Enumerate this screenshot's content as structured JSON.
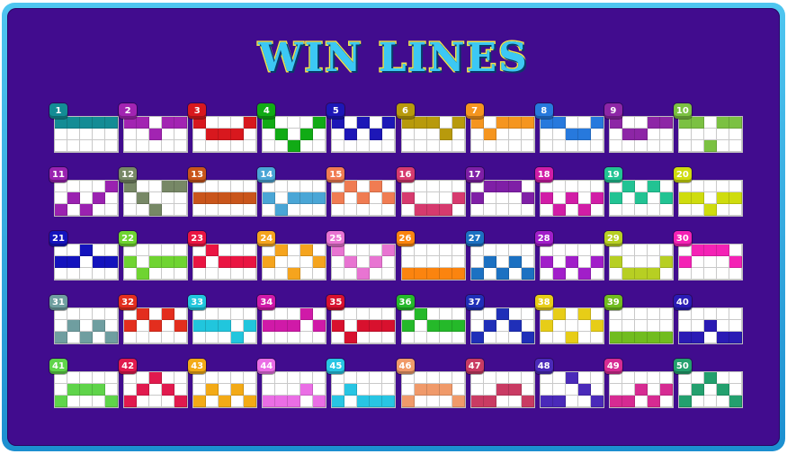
{
  "title": "WIN LINES",
  "lines": [
    {
      "num": "1",
      "color": "#138c95",
      "pattern": [
        0,
        0,
        0,
        0,
        0
      ]
    },
    {
      "num": "2",
      "color": "#a224b2",
      "pattern": [
        0,
        0,
        1,
        0,
        0
      ]
    },
    {
      "num": "3",
      "color": "#d8181e",
      "pattern": [
        0,
        1,
        1,
        1,
        0
      ]
    },
    {
      "num": "4",
      "color": "#11ab15",
      "pattern": [
        0,
        1,
        2,
        1,
        0
      ]
    },
    {
      "num": "5",
      "color": "#1d17b7",
      "pattern": [
        0,
        1,
        0,
        1,
        0
      ]
    },
    {
      "num": "6",
      "color": "#b89a0c",
      "pattern": [
        0,
        0,
        0,
        1,
        0
      ]
    },
    {
      "num": "7",
      "color": "#f5951f",
      "pattern": [
        0,
        1,
        0,
        0,
        0
      ]
    },
    {
      "num": "8",
      "color": "#2779dd",
      "pattern": [
        0,
        0,
        1,
        1,
        0
      ]
    },
    {
      "num": "9",
      "color": "#8d26a6",
      "pattern": [
        0,
        1,
        1,
        0,
        0
      ]
    },
    {
      "num": "10",
      "color": "#7bc142",
      "pattern": [
        0,
        0,
        2,
        0,
        0
      ]
    },
    {
      "num": "11",
      "color": "#9a22b0",
      "pattern": [
        2,
        1,
        2,
        1,
        0
      ]
    },
    {
      "num": "12",
      "color": "#778866",
      "pattern": [
        0,
        1,
        2,
        0,
        0
      ]
    },
    {
      "num": "13",
      "color": "#c9551b",
      "pattern": [
        1,
        1,
        1,
        1,
        1
      ]
    },
    {
      "num": "14",
      "color": "#4aa6d6",
      "pattern": [
        1,
        2,
        1,
        1,
        1
      ]
    },
    {
      "num": "15",
      "color": "#f07c52",
      "pattern": [
        1,
        0,
        1,
        0,
        1
      ]
    },
    {
      "num": "16",
      "color": "#d63a6e",
      "pattern": [
        1,
        2,
        2,
        2,
        1
      ]
    },
    {
      "num": "17",
      "color": "#7f1fa6",
      "pattern": [
        1,
        0,
        0,
        0,
        1
      ]
    },
    {
      "num": "18",
      "color": "#d11da6",
      "pattern": [
        1,
        2,
        1,
        2,
        1
      ]
    },
    {
      "num": "19",
      "color": "#22c393",
      "pattern": [
        1,
        0,
        1,
        0,
        1
      ]
    },
    {
      "num": "20",
      "color": "#cfdc0e",
      "pattern": [
        1,
        1,
        2,
        1,
        1
      ]
    },
    {
      "num": "21",
      "color": "#1413bd",
      "pattern": [
        1,
        1,
        0,
        1,
        1
      ]
    },
    {
      "num": "22",
      "color": "#6fd431",
      "pattern": [
        1,
        2,
        1,
        1,
        1
      ]
    },
    {
      "num": "23",
      "color": "#ea1542",
      "pattern": [
        1,
        0,
        1,
        1,
        1
      ]
    },
    {
      "num": "24",
      "color": "#f5a41e",
      "pattern": [
        1,
        0,
        2,
        0,
        1
      ]
    },
    {
      "num": "25",
      "color": "#e874d2",
      "pattern": [
        0,
        1,
        2,
        1,
        0
      ]
    },
    {
      "num": "26",
      "color": "#fb840f",
      "pattern": [
        2,
        2,
        2,
        2,
        2
      ]
    },
    {
      "num": "27",
      "color": "#1c71c2",
      "pattern": [
        2,
        1,
        2,
        1,
        2
      ]
    },
    {
      "num": "28",
      "color": "#a11ec9",
      "pattern": [
        1,
        2,
        1,
        2,
        1
      ]
    },
    {
      "num": "29",
      "color": "#b7cf23",
      "pattern": [
        1,
        2,
        2,
        2,
        1
      ]
    },
    {
      "num": "30",
      "color": "#f422b5",
      "pattern": [
        1,
        0,
        0,
        0,
        1
      ]
    },
    {
      "num": "31",
      "color": "#6f9ea0",
      "pattern": [
        2,
        1,
        2,
        1,
        2
      ]
    },
    {
      "num": "32",
      "color": "#e32e1e",
      "pattern": [
        1,
        0,
        1,
        0,
        1
      ]
    },
    {
      "num": "33",
      "color": "#21c6dd",
      "pattern": [
        1,
        1,
        1,
        2,
        1
      ]
    },
    {
      "num": "34",
      "color": "#d01aa8",
      "pattern": [
        1,
        1,
        1,
        0,
        1
      ]
    },
    {
      "num": "35",
      "color": "#d8112e",
      "pattern": [
        1,
        2,
        1,
        1,
        1
      ]
    },
    {
      "num": "36",
      "color": "#25b92a",
      "pattern": [
        1,
        0,
        1,
        1,
        1
      ]
    },
    {
      "num": "37",
      "color": "#1f2fb8",
      "pattern": [
        2,
        1,
        0,
        1,
        2
      ]
    },
    {
      "num": "38",
      "color": "#e7cd17",
      "pattern": [
        1,
        0,
        2,
        0,
        1
      ]
    },
    {
      "num": "39",
      "color": "#71bc1f",
      "pattern": [
        2,
        2,
        2,
        2,
        2
      ]
    },
    {
      "num": "40",
      "color": "#2a1bb4",
      "pattern": [
        2,
        2,
        1,
        2,
        2
      ]
    },
    {
      "num": "41",
      "color": "#5fd44a",
      "pattern": [
        2,
        1,
        1,
        1,
        2
      ]
    },
    {
      "num": "42",
      "color": "#e11a4e",
      "pattern": [
        2,
        1,
        0,
        1,
        2
      ]
    },
    {
      "num": "43",
      "color": "#f3aa16",
      "pattern": [
        2,
        1,
        2,
        1,
        2
      ]
    },
    {
      "num": "44",
      "color": "#ea6ee5",
      "pattern": [
        2,
        2,
        2,
        1,
        2
      ]
    },
    {
      "num": "45",
      "color": "#28c5e3",
      "pattern": [
        2,
        1,
        2,
        2,
        2
      ]
    },
    {
      "num": "46",
      "color": "#f09a6a",
      "pattern": [
        2,
        1,
        1,
        1,
        2
      ]
    },
    {
      "num": "47",
      "color": "#c93b63",
      "pattern": [
        2,
        2,
        1,
        1,
        2
      ]
    },
    {
      "num": "48",
      "color": "#4a2ab9",
      "pattern": [
        2,
        2,
        0,
        1,
        2
      ]
    },
    {
      "num": "49",
      "color": "#d62b92",
      "pattern": [
        2,
        2,
        1,
        2,
        1
      ]
    },
    {
      "num": "50",
      "color": "#23a06e",
      "pattern": [
        2,
        1,
        0,
        1,
        2
      ]
    }
  ]
}
